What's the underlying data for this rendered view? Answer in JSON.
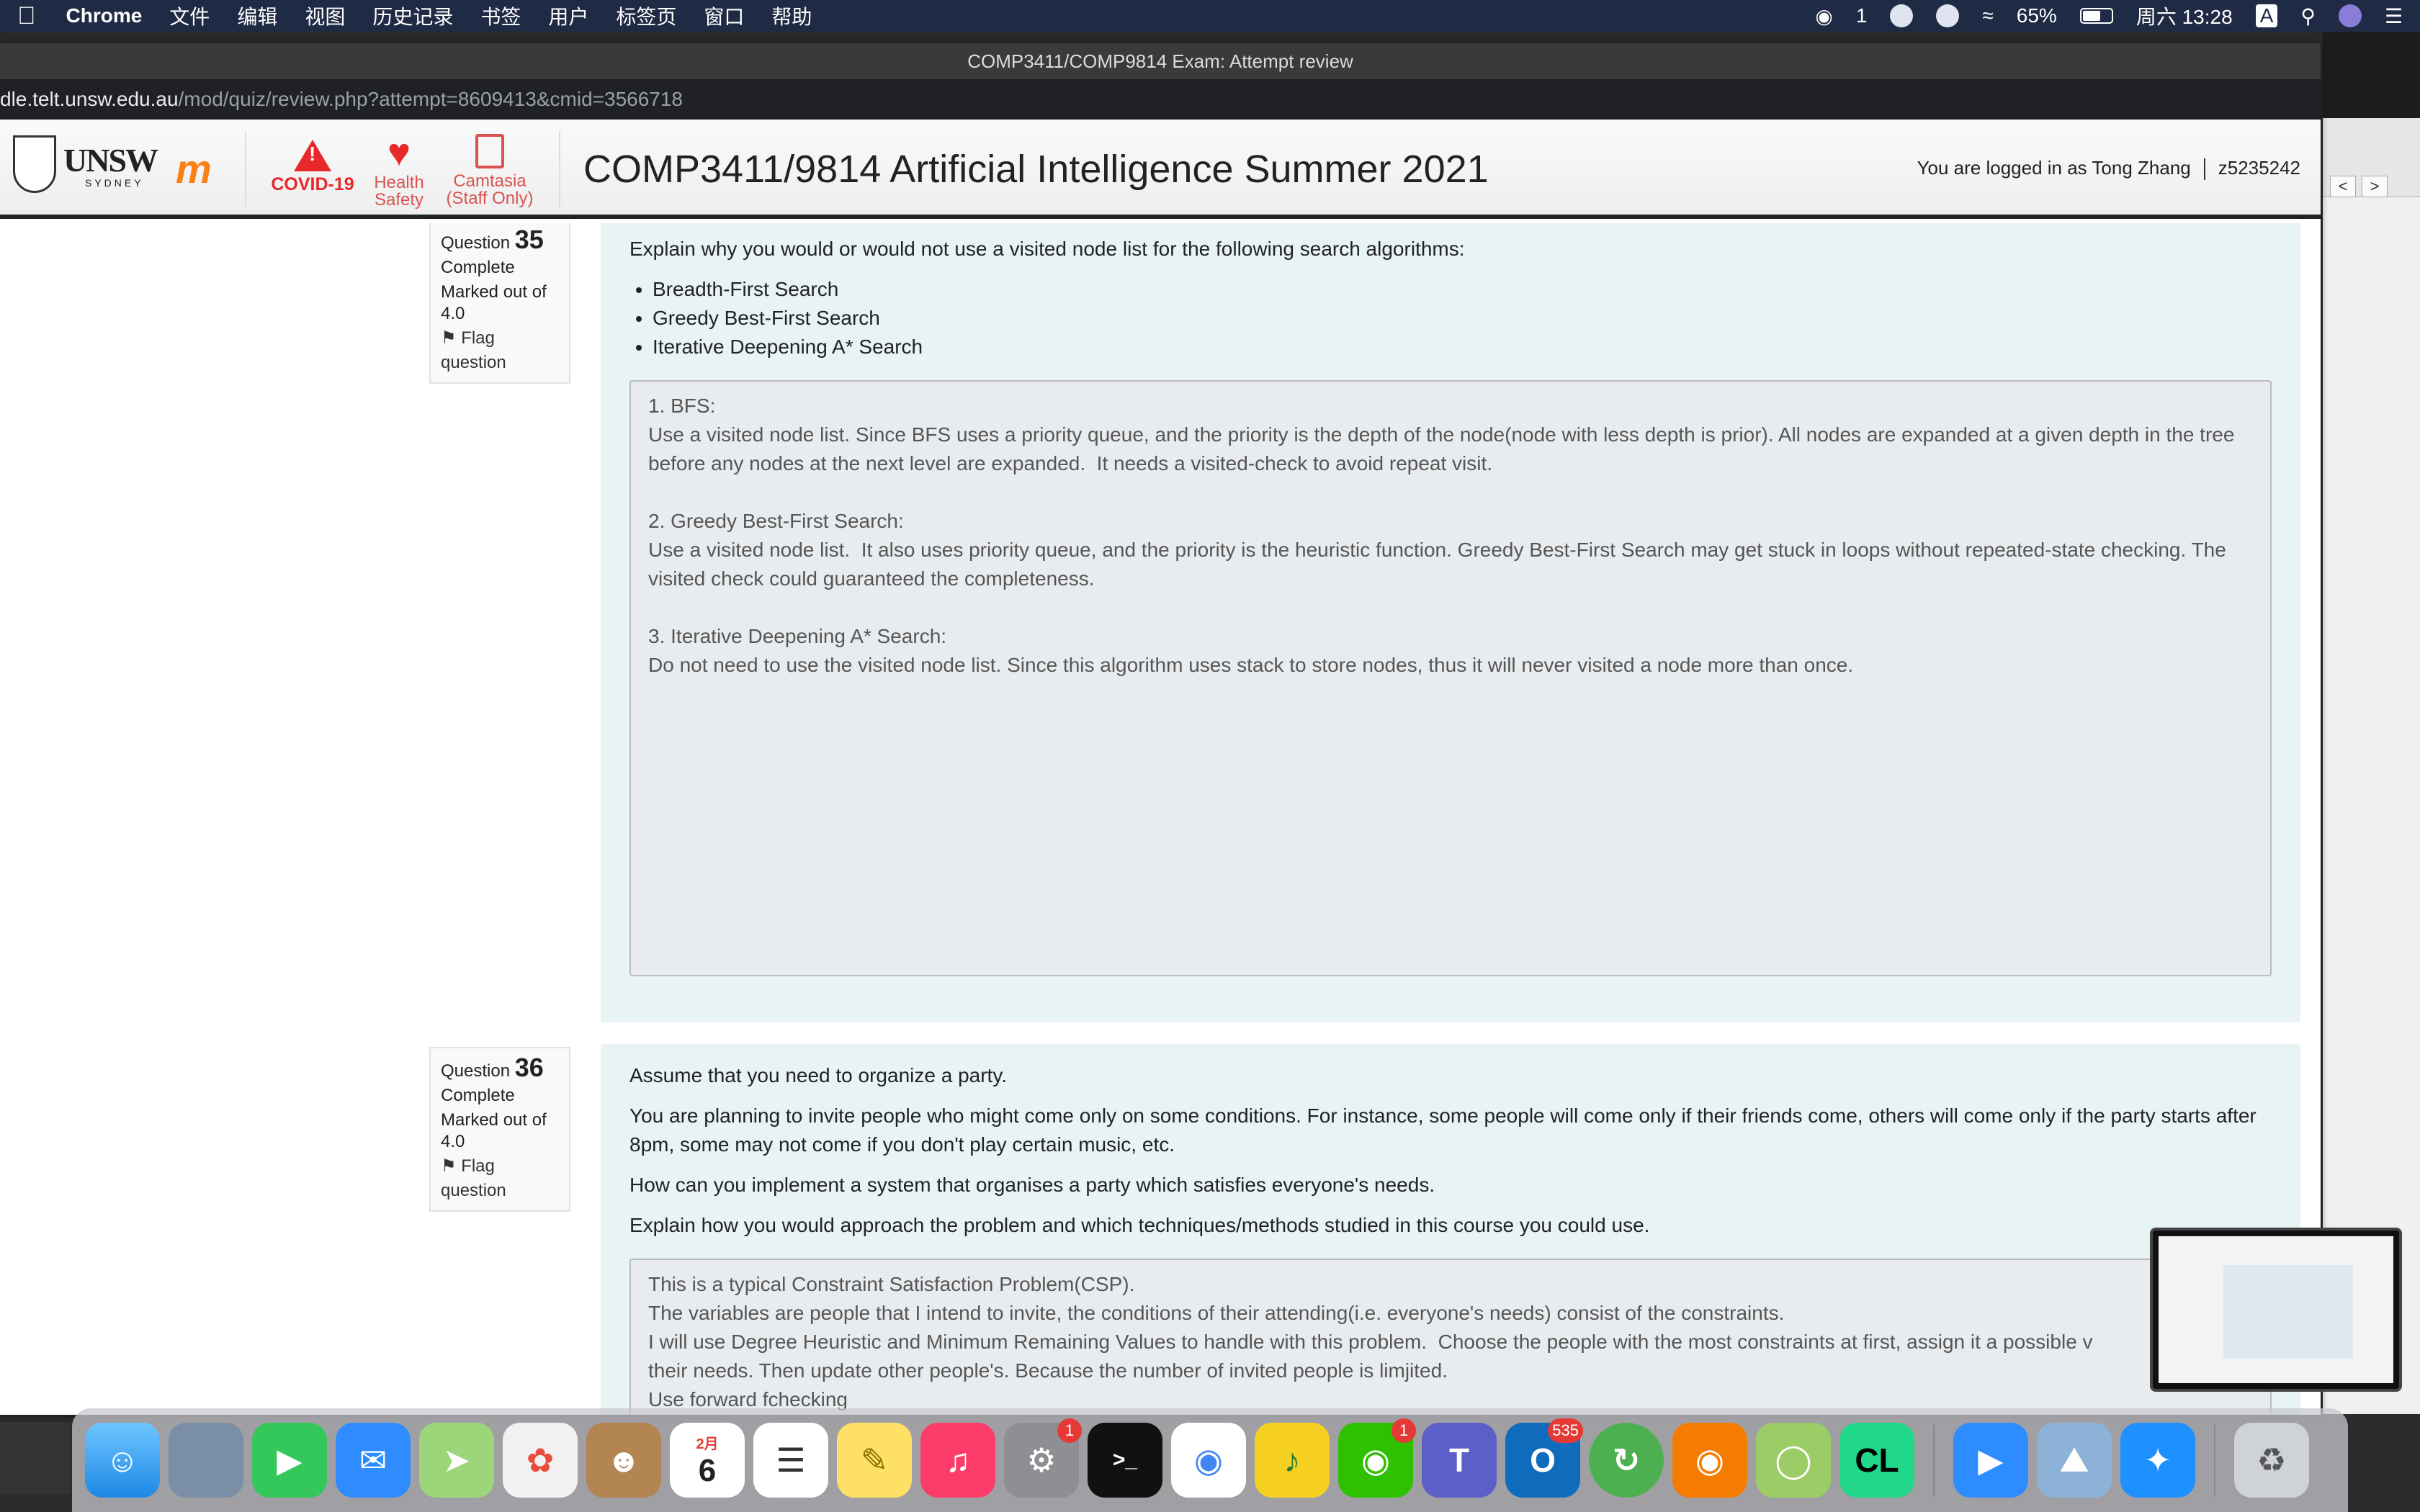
{
  "menubar": {
    "app": "Chrome",
    "items": [
      "文件",
      "编辑",
      "视图",
      "历史记录",
      "书签",
      "用户",
      "标签页",
      "窗口",
      "帮助"
    ],
    "wechat_count": "1",
    "battery": "65%",
    "clock": "周六 13:28",
    "input_method": "A"
  },
  "window": {
    "title": "COMP3411/COMP9814 Exam: Attempt review",
    "url_host": "dle.telt.unsw.edu.au",
    "url_path": "/mod/quiz/review.php?attempt=8609413&cmid=3566718"
  },
  "header": {
    "logo_text": "UNSW",
    "logo_sub": "SYDNEY",
    "covid": "COVID-19",
    "health_line1": "Health",
    "health_line2": "Safety",
    "camtasia_line1": "Camtasia",
    "camtasia_line2": "(Staff Only)",
    "course_title": "COMP3411/9814 Artificial Intelligence Summer 2021",
    "login_text": "You are logged in as Tong Zhang",
    "zid": "z5235242"
  },
  "questions": [
    {
      "label": "Question",
      "number": "35",
      "status": "Complete",
      "marked": "Marked out of",
      "mark": "4.0",
      "flag": "Flag",
      "flag2": "question",
      "prompt": "Explain why you would or would not use a visited node list for the following search algorithms:",
      "bullets": [
        "Breadth-First Search",
        "Greedy Best-First Search",
        "Iterative Deepening A* Search"
      ],
      "answer": "1. BFS:\nUse a visited node list. Since BFS uses a priority queue, and the priority is the depth of the node(node with less depth is prior). All nodes are expanded at a given depth in the tree before any nodes at the next level are expanded.  It needs a visited-check to avoid repeat visit.\n\n2. Greedy Best-First Search:\nUse a visited node list.  It also uses priority queue, and the priority is the heuristic function. Greedy Best-First Search may get stuck in loops without repeated-state checking. The visited check could guaranteed the completeness.\n\n3. Iterative Deepening A* Search:\nDo not need to use the visited node list. Since this algorithm uses stack to store nodes, thus it will never visited a node more than once."
    },
    {
      "label": "Question",
      "number": "36",
      "status": "Complete",
      "marked": "Marked out of",
      "mark": "4.0",
      "flag": "Flag",
      "flag2": "question",
      "p1": "Assume that you need to organize a party.",
      "p2": "You are planning to invite people who might come only on some conditions. For instance, some people will come only if their friends come, others will come only if the party starts after 8pm, some may not come if you don't play certain music, etc.",
      "p3": "How can you implement a system that organises a party which satisfies everyone's needs.",
      "p4": "Explain how you would approach the problem and which techniques/methods studied in this course you could use.",
      "answer": "This is a typical Constraint Satisfaction Problem(CSP).\nThe variables are people that I intend to invite, the conditions of their attending(i.e. everyone's needs) consist of the constraints.\nI will use Degree Heuristic and Minimum Remaining Values to handle with this problem.  Choose the people with the most constraints at first, assign it a possible v\ntheir needs. Then update other people's. Because the number of invited people is limjited.\nUse forward fchecking"
    }
  ],
  "dock": {
    "calendar_month": "2月",
    "calendar_day": "6",
    "badge_settings": "1",
    "badge_wechat": "1",
    "badge_outlook": "535"
  },
  "colors": {
    "question_bg": "#e7f3f5",
    "answer_bg": "#e9ecef",
    "alert_red": "#e8282a",
    "menubar_bg": "#1f2a44"
  }
}
